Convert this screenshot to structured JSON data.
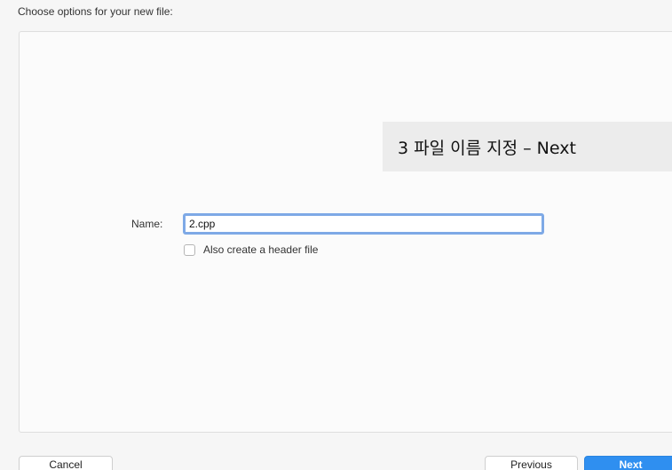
{
  "dialog": {
    "header": "Choose options for your new file:",
    "annotation": "3 파일 이름 지정 – Next",
    "form": {
      "name_label": "Name:",
      "name_value": "2.cpp",
      "header_checkbox_label": "Also create a header file",
      "header_checkbox_checked": false
    },
    "buttons": {
      "cancel": "Cancel",
      "previous": "Previous",
      "next": "Next"
    }
  }
}
